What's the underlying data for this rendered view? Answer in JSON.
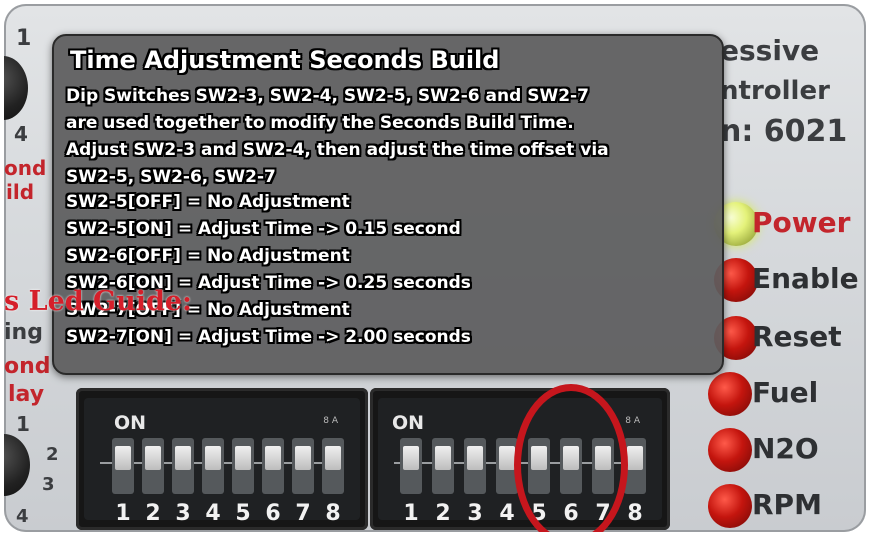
{
  "board": {
    "top_right_lines": [
      "essive",
      "ntroller",
      "n: 6021"
    ],
    "left_numbers": [
      "1",
      "4",
      "1",
      "2",
      "3",
      "4"
    ],
    "left_red_fragments": [
      "ond",
      "ild",
      "ond",
      "lay"
    ],
    "left_dark_fragments": [
      "ing"
    ],
    "leds": [
      {
        "label": "Power",
        "color": "#c4150e"
      },
      {
        "label": "Enable",
        "color": "#c4150e"
      },
      {
        "label": "Reset",
        "color": "#c4150e"
      },
      {
        "label": "Fuel",
        "color": "#c4150e"
      },
      {
        "label": "N2O",
        "color": "#c4150e"
      },
      {
        "label": "RPM",
        "color": "#c4150e"
      }
    ],
    "dip_blocks": [
      {
        "on_label": "ON",
        "numbers": [
          "1",
          "2",
          "3",
          "4",
          "5",
          "6",
          "7",
          "8"
        ]
      },
      {
        "on_label": "ON",
        "numbers": [
          "1",
          "2",
          "3",
          "4",
          "5",
          "6",
          "7",
          "8"
        ]
      }
    ],
    "guide_label": "s Led Guide:"
  },
  "overlay": {
    "title": "Time Adjustment Seconds Build",
    "lines": [
      "Dip Switches SW2-3, SW2-4, SW2-5, SW2-6 and SW2-7",
      "are used together to modify the Seconds Build Time.",
      "Adjust SW2-3 and SW2-4,  then adjust the time offset via",
      "SW2-5, SW2-6, SW2-7",
      "SW2-5[OFF] = No Adjustment",
      "SW2-5[ON] =   Adjust Time -> 0.15 second",
      "SW2-6[OFF] = No Adjustment",
      "SW2-6[ON] =   Adjust Time -> 0.25 seconds",
      "SW2-7[OFF] = No Adjustment",
      "SW2-7[ON] =   Adjust Time -> 2.00 seconds"
    ]
  },
  "colors": {
    "highlight": "#c6161d",
    "overlay_bg": "#5c5c5e",
    "guide_text": "#d51f2a"
  }
}
